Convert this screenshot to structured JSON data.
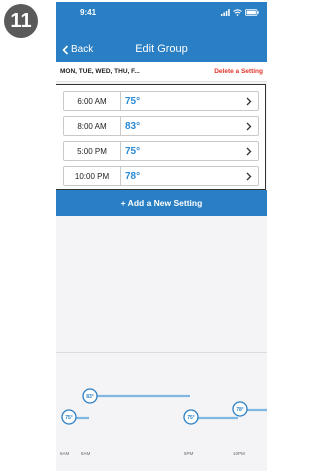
{
  "step_badge": "11",
  "status": {
    "time": "9:41"
  },
  "nav": {
    "back_label": "Back",
    "title": "Edit Group"
  },
  "subheader": {
    "days": "MON, TUE, WED, THU, F...",
    "delete_label": "Delete a Setting"
  },
  "settings": [
    {
      "time": "6:00 AM",
      "temp": "75°"
    },
    {
      "time": "8:00 AM",
      "temp": "83°"
    },
    {
      "time": "5:00 PM",
      "temp": "75°"
    },
    {
      "time": "10:00 PM",
      "temp": "78°"
    }
  ],
  "add_button_label": "+ Add a New Setting",
  "timeline": {
    "markers": [
      {
        "label": "75°"
      },
      {
        "label": "83°"
      },
      {
        "label": "75°"
      },
      {
        "label": "78°"
      }
    ],
    "axis_labels": [
      "6AM",
      "8AM",
      "5PM",
      "10PM"
    ]
  },
  "colors": {
    "accent": "#2a7fc4",
    "temp_text": "#2a8ad6",
    "delete": "#e0342a"
  }
}
